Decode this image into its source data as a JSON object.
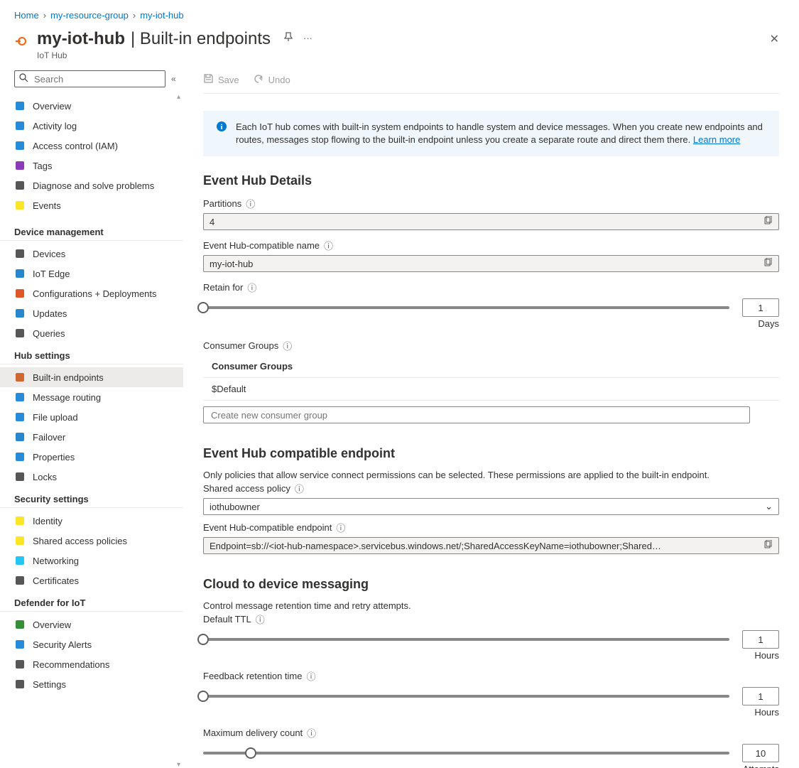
{
  "breadcrumb": {
    "home": "Home",
    "rg": "my-resource-group",
    "hub": "my-iot-hub"
  },
  "header": {
    "title_strong": "my-iot-hub",
    "title_rest": "Built-in endpoints",
    "subtitle": "IoT Hub"
  },
  "toolbar": {
    "save": "Save",
    "undo": "Undo"
  },
  "search": {
    "placeholder": "Search"
  },
  "sidebar": {
    "top": [
      {
        "label": "Overview"
      },
      {
        "label": "Activity log"
      },
      {
        "label": "Access control (IAM)"
      },
      {
        "label": "Tags"
      },
      {
        "label": "Diagnose and solve problems"
      },
      {
        "label": "Events"
      }
    ],
    "groups": [
      {
        "heading": "Device management",
        "items": [
          {
            "label": "Devices"
          },
          {
            "label": "IoT Edge"
          },
          {
            "label": "Configurations + Deployments"
          },
          {
            "label": "Updates"
          },
          {
            "label": "Queries"
          }
        ]
      },
      {
        "heading": "Hub settings",
        "items": [
          {
            "label": "Built-in endpoints",
            "active": true
          },
          {
            "label": "Message routing"
          },
          {
            "label": "File upload"
          },
          {
            "label": "Failover"
          },
          {
            "label": "Properties"
          },
          {
            "label": "Locks"
          }
        ]
      },
      {
        "heading": "Security settings",
        "items": [
          {
            "label": "Identity"
          },
          {
            "label": "Shared access policies"
          },
          {
            "label": "Networking"
          },
          {
            "label": "Certificates"
          }
        ]
      },
      {
        "heading": "Defender for IoT",
        "items": [
          {
            "label": "Overview"
          },
          {
            "label": "Security Alerts"
          },
          {
            "label": "Recommendations"
          },
          {
            "label": "Settings"
          }
        ]
      }
    ]
  },
  "info": {
    "text": "Each IoT hub comes with built-in system endpoints to handle system and device messages. When you create new endpoints and routes, messages stop flowing to the built-in endpoint unless you create a separate route and direct them there. ",
    "link": "Learn more"
  },
  "ehDetails": {
    "heading": "Event Hub Details",
    "partitions_label": "Partitions",
    "partitions_value": "4",
    "name_label": "Event Hub-compatible name",
    "name_value": "my-iot-hub",
    "retain_label": "Retain for",
    "retain_value": "1",
    "retain_unit": "Days",
    "cg_label": "Consumer Groups",
    "cg_header": "Consumer Groups",
    "cg_default": "$Default",
    "cg_placeholder": "Create new consumer group"
  },
  "ehEndpoint": {
    "heading": "Event Hub compatible endpoint",
    "hint": "Only policies that allow service connect permissions can be selected. These permissions are applied to the built-in endpoint.",
    "policy_label": "Shared access policy",
    "policy_value": "iothubowner",
    "endpoint_label": "Event Hub-compatible endpoint",
    "endpoint_value": "Endpoint=sb://<iot-hub-namespace>.servicebus.windows.net/;SharedAccessKeyName=iothubowner;Shared…"
  },
  "c2d": {
    "heading": "Cloud to device messaging",
    "hint": "Control message retention time and retry attempts.",
    "ttl_label": "Default TTL",
    "ttl_value": "1",
    "ttl_unit": "Hours",
    "fb_label": "Feedback retention time",
    "fb_value": "1",
    "fb_unit": "Hours",
    "max_label": "Maximum delivery count",
    "max_value": "10",
    "max_unit": "Attempts"
  }
}
